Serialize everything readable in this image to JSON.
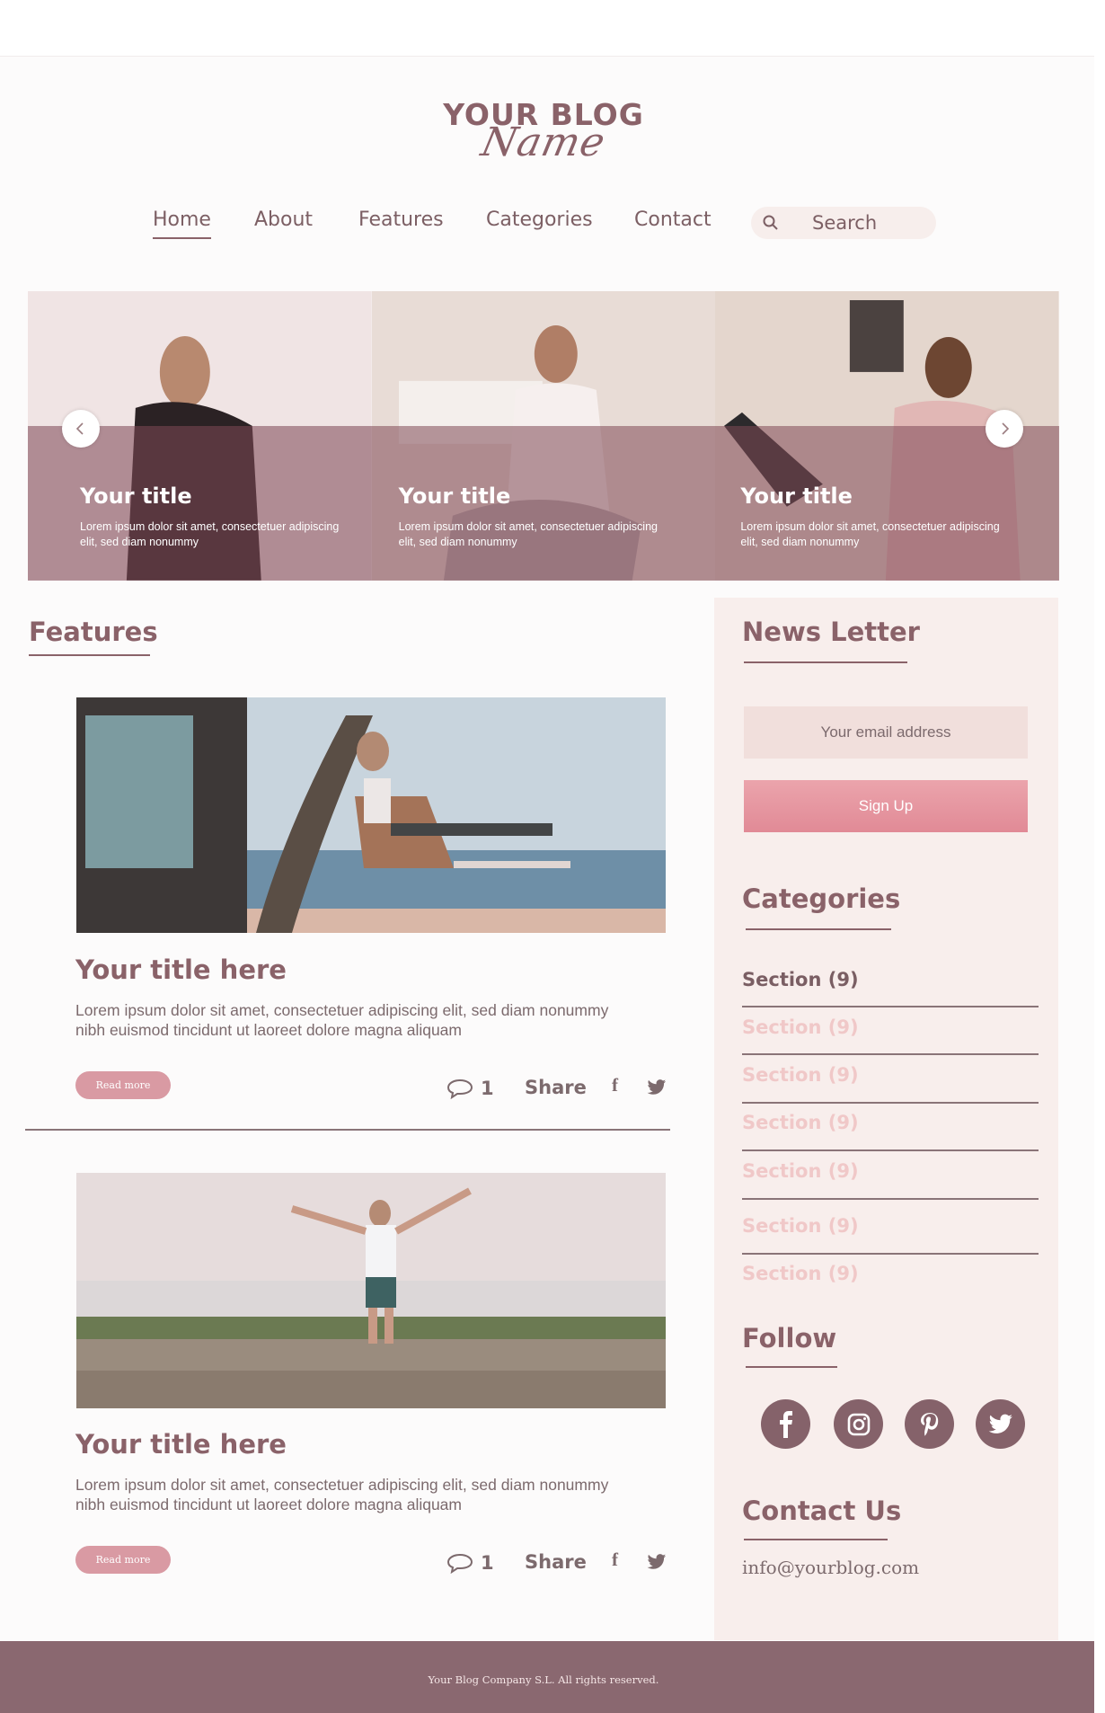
{
  "logo": {
    "line1": "YOUR BLOG",
    "line2": "Name"
  },
  "nav": {
    "items": [
      "Home",
      "About",
      "Features",
      "Categories",
      "Contact"
    ],
    "active": "Home",
    "search_placeholder": "Search"
  },
  "hero": {
    "slides": [
      {
        "title": "Your title",
        "text": "Lorem ipsum dolor sit amet, consectetuer adipiscing elit, sed diam nonummy"
      },
      {
        "title": "Your title",
        "text": "Lorem ipsum dolor sit amet, consectetuer adipiscing elit, sed diam nonummy"
      },
      {
        "title": "Your title",
        "text": "Lorem ipsum dolor sit amet, consectetuer adipiscing elit, sed diam nonummy"
      }
    ],
    "prev_icon": "chevron-left-icon",
    "next_icon": "chevron-right-icon"
  },
  "features": {
    "heading": "Features",
    "posts": [
      {
        "title": "Your title here",
        "excerpt": "Lorem ipsum dolor sit amet, consectetuer adipiscing elit, sed diam nonummy nibh euismod tincidunt ut laoreet dolore magna aliquam",
        "read_more": "Read more",
        "comments": "1",
        "share": "Share"
      },
      {
        "title": "Your title here",
        "excerpt": "Lorem ipsum dolor sit amet, consectetuer adipiscing elit, sed diam nonummy nibh euismod tincidunt ut laoreet dolore magna aliquam",
        "read_more": "Read more",
        "comments": "1",
        "share": "Share"
      }
    ]
  },
  "sidebar": {
    "newsletter": {
      "heading": "News Letter",
      "email_placeholder": "Your email address",
      "button": "Sign Up"
    },
    "categories": {
      "heading": "Categories",
      "items": [
        "Section  (9)",
        "Section  (9)",
        "Section  (9)",
        "Section  (9)",
        "Section  (9)",
        "Section  (9)",
        "Section  (9)"
      ]
    },
    "follow": {
      "heading": "Follow",
      "icons": [
        "facebook-icon",
        "instagram-icon",
        "pinterest-icon",
        "twitter-icon"
      ]
    },
    "contact": {
      "heading": "Contact Us",
      "email": "info@yourblog.com"
    }
  },
  "footer": {
    "text": "Your Blog Company S.L. All rights reserved."
  },
  "colors": {
    "brand": "#8a6269",
    "accent": "#e18a96",
    "sidebar_bg": "#f8eeec",
    "footer_bg": "#8a6870"
  }
}
